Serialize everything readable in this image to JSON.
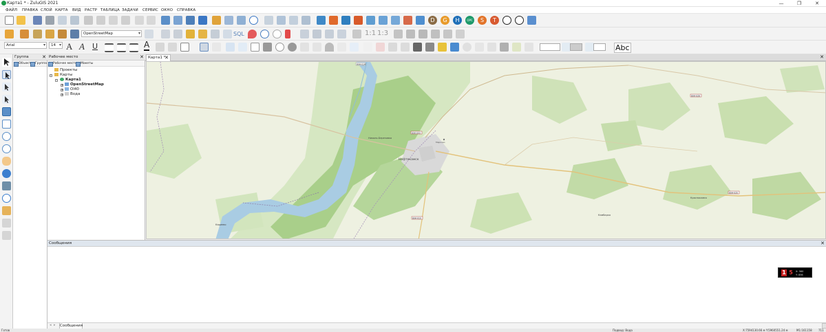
{
  "window": {
    "title": "Карта1 * - ZuluGIS 2021",
    "controls": [
      "—",
      "❐",
      "✕"
    ]
  },
  "menu": [
    "ФАЙЛ",
    "ПРАВКА",
    "СЛОЙ",
    "КАРТА",
    "ВИД",
    "РАСТР",
    "ТАБЛИЦА",
    "ЗАДАЧИ",
    "СЕРВИС",
    "ОКНО",
    "СПРАВКА"
  ],
  "toolbar": {
    "row1_letters": [
      "D",
      "G",
      "H",
      "OPC",
      "S",
      "T"
    ],
    "layer_select": "OpenStreetMap",
    "sql_label": "SQL",
    "scale_label": "1:1",
    "scale_label2": "1:3",
    "font_name": "Arial",
    "font_size": "14",
    "font_a": "A",
    "font_a_italic": "A",
    "underline": "U",
    "text_color_a": "A",
    "abc_label": "Abc"
  },
  "panels": {
    "group": {
      "title": "Группа",
      "tabs": [
        "Объект",
        "Группа"
      ]
    },
    "workspace": {
      "title": "Рабочее место",
      "tabs": [
        "Рабочее место",
        "Макеты"
      ],
      "tree": {
        "projects": "Проекты",
        "maps": "Карты",
        "map1": "Карта1",
        "layers": [
          "OpenStreetMap",
          "Ol40",
          "Вода"
        ]
      }
    },
    "messages": {
      "title": "Сообщения",
      "tab": "Сообщения"
    }
  },
  "map": {
    "tab": "Карта1 *",
    "labels": {
      "city": "Нефтекамск",
      "town2": "Николо-Березовка",
      "town3": "Кариево",
      "town4": "Камбарка",
      "town5": "Краснокамск",
      "road1": "80К-003",
      "road2": "80К-028",
      "road3": "80К-015",
      "road4": "80Н-025",
      "road5": "80Н-014",
      "vil": "Марково"
    }
  },
  "compass": {
    "n1": "1",
    "n2": "5",
    "t1": "X: 560",
    "t2": "Y: 856"
  },
  "status": {
    "left": "Готов",
    "layer": "Подвод: Вода",
    "coords": "X:7594130.66 м  Y:5960551.24 м",
    "scale": "M1:161158",
    "extra": "711"
  },
  "colors": {
    "accent": "#1e9a4b",
    "river": "#a9cce3",
    "forest": "#b5d69a",
    "farmland": "#eef1e1",
    "urban": "#d9d9d9"
  }
}
